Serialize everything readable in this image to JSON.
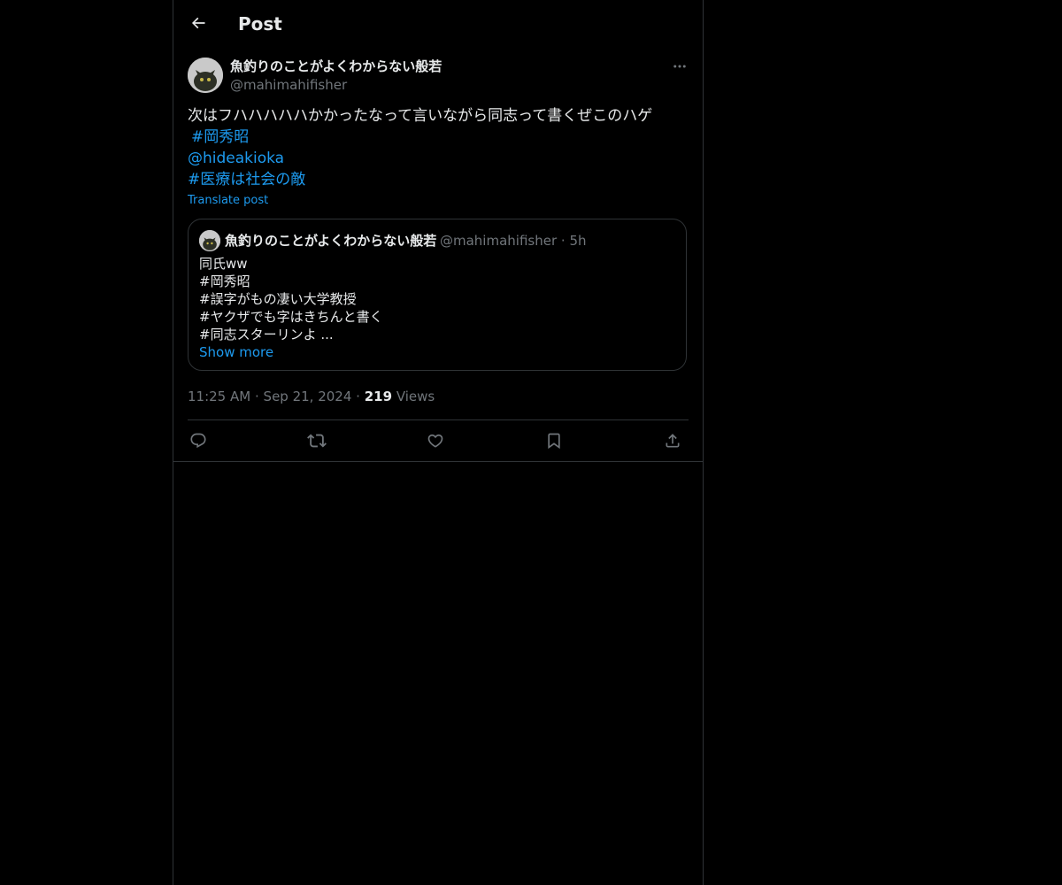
{
  "header": {
    "title": "Post",
    "back_icon": "arrow-left-icon"
  },
  "post": {
    "author_name": "魚釣りのことがよくわからない般若",
    "author_handle": "@mahimahifisher",
    "more_icon": "more-horizontal-icon",
    "text_line": "次はフハハハハハかかったなって言いながら同志って書くぜこのハゲ",
    "hashtag_1": "#岡秀昭",
    "mention": "@hideakioka",
    "hashtag_2": "#医療は社会の敵",
    "translate_label": "Translate post",
    "time": "11:25 AM",
    "separator": "·",
    "date": "Sep 21, 2024",
    "views_count": "219",
    "views_label": "Views"
  },
  "quote": {
    "author_name": "魚釣りのことがよくわからない般若",
    "author_handle": "@mahimahifisher",
    "separator": "·",
    "age": "5h",
    "lines": [
      "同氏ww",
      "#岡秀昭",
      "#誤字がもの凄い大学教授",
      "#ヤクザでも字はきちんと書く",
      "#同志スターリンよ ..."
    ],
    "show_more": "Show more"
  },
  "actions": {
    "reply_icon": "reply-icon",
    "repost_icon": "repost-icon",
    "like_icon": "heart-icon",
    "bookmark_icon": "bookmark-icon",
    "share_icon": "share-icon"
  },
  "colors": {
    "background": "#000000",
    "text": "#e7e9ea",
    "secondary": "#71767b",
    "accent": "#1d9bf0",
    "border": "#2f3336"
  }
}
